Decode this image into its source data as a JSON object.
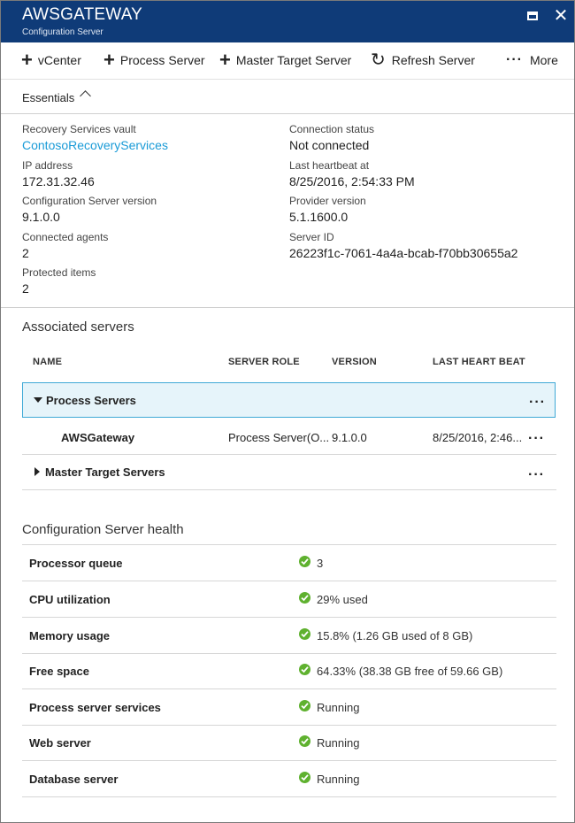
{
  "window": {
    "title": "AWSGATEWAY",
    "subtitle": "Configuration Server"
  },
  "commands": {
    "vcenter": "vCenter",
    "process_server": "Process Server",
    "master_target": "Master Target Server",
    "refresh": "Refresh Server",
    "more": "More"
  },
  "essentials": {
    "label": "Essentials",
    "vault_label": "Recovery Services vault",
    "vault_value": "ContosoRecoveryServices",
    "ip_label": "IP address",
    "ip_value": "172.31.32.46",
    "cs_version_label": "Configuration Server version",
    "cs_version_value": "9.1.0.0",
    "agents_label": "Connected agents",
    "agents_value": "2",
    "protected_label": "Protected items",
    "protected_value": "2",
    "conn_label": "Connection status",
    "conn_value": "Not connected",
    "heartbeat_label": "Last heartbeat at",
    "heartbeat_value": "8/25/2016, 2:54:33 PM",
    "provider_label": "Provider version",
    "provider_value": "5.1.1600.0",
    "serverid_label": "Server ID",
    "serverid_value": "26223f1c-7061-4a4a-bcab-f70bb30655a2"
  },
  "associated": {
    "title": "Associated servers",
    "columns": [
      "NAME",
      "SERVER ROLE",
      "VERSION",
      "LAST HEART BEAT"
    ],
    "group1": "Process Servers",
    "row": {
      "name": "AWSGateway",
      "role": "Process Server(O...",
      "version": "9.1.0.0",
      "heartbeat": "8/25/2016, 2:46..."
    },
    "group2": "Master Target Servers",
    "more": "..."
  },
  "health": {
    "title": "Configuration Server health",
    "status_color": "#5fb12f",
    "rows": [
      {
        "label": "Processor queue",
        "value": "3"
      },
      {
        "label": "CPU utilization",
        "value": "29% used"
      },
      {
        "label": "Memory usage",
        "value": "15.8% (1.26 GB used of 8 GB)"
      },
      {
        "label": "Free space",
        "value": "64.33% (38.38 GB free of 59.66 GB)"
      },
      {
        "label": "Process server services",
        "value": "Running"
      },
      {
        "label": "Web server",
        "value": "Running"
      },
      {
        "label": "Database server",
        "value": "Running"
      }
    ]
  }
}
